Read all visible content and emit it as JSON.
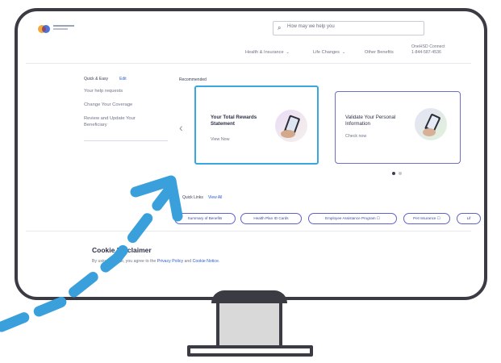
{
  "header": {
    "search_placeholder": "How may we help you",
    "nav": [
      {
        "label": "Health & Insurance"
      },
      {
        "label": "Life Changes"
      },
      {
        "label": "Other Benefits"
      }
    ],
    "connect_title": "OneHSD Connect",
    "connect_phone": "1-844-587-4536"
  },
  "quick_easy": {
    "title": "Quick & Easy",
    "edit_label": "Edit",
    "links": [
      "Your help requests",
      "Change Your Coverage",
      "Review and Update Your",
      "Beneficiary"
    ]
  },
  "recommended": {
    "title": "Recommended",
    "cards": [
      {
        "title_line1": "Your Total Rewards",
        "title_line2": "Statement",
        "action": "View Now"
      },
      {
        "title_line1": "Validate Your Personal",
        "title_line2": "Information",
        "action": "Check now"
      }
    ]
  },
  "quick_links": {
    "title": "Quick Links",
    "view_all": "View All",
    "pills": [
      "Summary of Benefits",
      "Health Plan ID Cards",
      "Employee Assistance Program ☐",
      "Pet Insurance ☐",
      "Lif"
    ]
  },
  "cookie": {
    "title": "Cookie Disclaimer",
    "text_before": "By using this site, you agree to the ",
    "privacy_link": "Privacy Policy",
    "text_mid": " and ",
    "cookie_link": "Cookie Notice",
    "text_after": "."
  },
  "colors": {
    "card_highlight": "#39a7e0",
    "accent": "#5e63c7",
    "arrow": "#3aa0dc",
    "bezel": "#3b3b44"
  },
  "carousel": {
    "dots": 2,
    "active_dot": 1
  }
}
